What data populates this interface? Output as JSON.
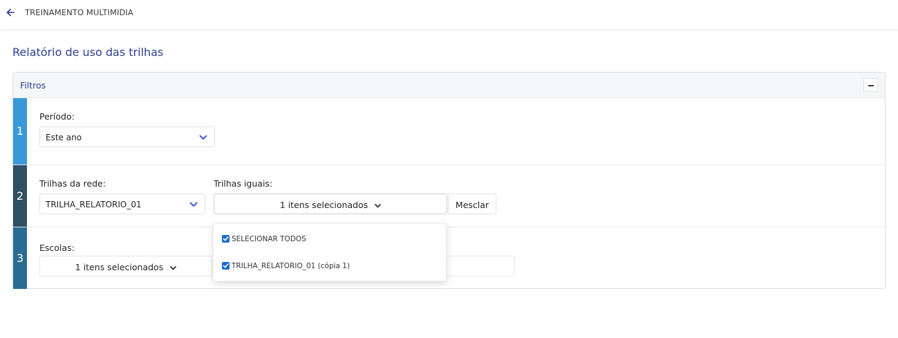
{
  "header": {
    "title": "TREINAMENTO MULTIMIDIA"
  },
  "page": {
    "title": "Relatório de uso das trilhas"
  },
  "filters": {
    "label": "Filtros",
    "steps": [
      {
        "number": "1"
      },
      {
        "number": "2"
      },
      {
        "number": "3"
      }
    ],
    "periodo": {
      "label": "Período:",
      "value": "Este ano"
    },
    "trilhas_rede": {
      "label": "Trilhas da rede:",
      "value": "TRILHA_RELATORIO_01"
    },
    "trilhas_iguais": {
      "label": "Trilhas iguais:",
      "value": "1 itens selecionados"
    },
    "mesclar": {
      "label": "Mesclar"
    },
    "escolas": {
      "label": "Escolas:",
      "value": "1 itens selecionados"
    }
  },
  "dropdown": {
    "items": [
      {
        "label": "SELECIONAR TODOS",
        "checked": true
      },
      {
        "label": "TRILHA_RELATORIO_01 (cópia 1)",
        "checked": true
      }
    ]
  },
  "colors": {
    "accent": "#2b3d8f",
    "step1": "#3a9ad9",
    "step2": "#2f4f63",
    "step3": "#2a6b91",
    "checkbox": "#1a6ad6"
  }
}
